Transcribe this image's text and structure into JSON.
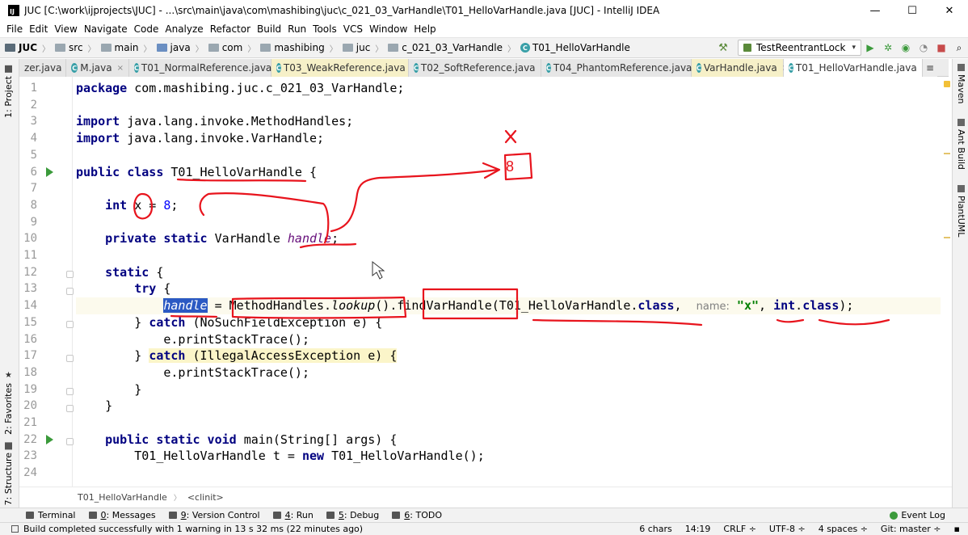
{
  "window": {
    "app_icon": "IJ",
    "title": "JUC [C:\\work\\ijprojects\\JUC] - ...\\src\\main\\java\\com\\mashibing\\juc\\c_021_03_VarHandle\\T01_HelloVarHandle.java [JUC] - IntelliJ IDEA",
    "minimize": "—",
    "maximize": "☐",
    "close": "✕"
  },
  "menu": [
    "File",
    "Edit",
    "View",
    "Navigate",
    "Code",
    "Analyze",
    "Refactor",
    "Build",
    "Run",
    "Tools",
    "VCS",
    "Window",
    "Help"
  ],
  "navbar": {
    "crumbs": [
      "JUC",
      "src",
      "main",
      "java",
      "com",
      "mashibing",
      "juc",
      "c_021_03_VarHandle",
      "T01_HelloVarHandle"
    ],
    "run_config": "TestReentrantLock",
    "hammer_icon": "hammer-icon",
    "run_icon": "run-icon",
    "debug_icon": "debug-icon"
  },
  "tabs": [
    {
      "label": "zer.java",
      "icon": "",
      "style": "plain"
    },
    {
      "label": "M.java",
      "icon": "C",
      "style": "plain"
    },
    {
      "label": "T01_NormalReference.java",
      "icon": "C",
      "style": "plain"
    },
    {
      "label": "T03_WeakReference.java",
      "icon": "C",
      "style": "yellow"
    },
    {
      "label": "T02_SoftReference.java",
      "icon": "C",
      "style": "plain"
    },
    {
      "label": "T04_PhantomReference.java",
      "icon": "C",
      "style": "plain"
    },
    {
      "label": "VarHandle.java",
      "icon": "C",
      "style": "yellow"
    },
    {
      "label": "T01_HelloVarHandle.java",
      "icon": "C",
      "style": "active"
    }
  ],
  "tab_overflow": "≡",
  "tab_close": "×",
  "left_tools": {
    "project": "1: Project",
    "favorites": "2: Favorites",
    "structure": "7: Structure"
  },
  "right_tools": {
    "maven": "Maven",
    "ant": "Ant Build",
    "plantuml": "PlantUML"
  },
  "code": {
    "line_numbers": [
      "1",
      "2",
      "3",
      "4",
      "5",
      "6",
      "7",
      "8",
      "9",
      "10",
      "11",
      "12",
      "13",
      "14",
      "15",
      "16",
      "17",
      "18",
      "19",
      "20",
      "21",
      "22",
      "23",
      "24"
    ],
    "l1": {
      "kw": "package",
      "rest": " com.mashibing.juc.c_021_03_VarHandle;"
    },
    "l3": {
      "kw": "import",
      "rest": " java.lang.invoke.MethodHandles;"
    },
    "l4": {
      "kw": "import",
      "rest": " java.lang.invoke.VarHandle;"
    },
    "l6": {
      "kw": "public class",
      "rest": " T01_HelloVarHandle {"
    },
    "l8": {
      "indent": "    ",
      "kw": "int",
      "mid": " x = ",
      "num": "8",
      "end": ";"
    },
    "l10": {
      "indent": "    ",
      "kw": "private static",
      "mid": " VarHandle ",
      "fld": "handle",
      "end": ";"
    },
    "l12": {
      "indent": "    ",
      "kw": "static",
      "rest": " {"
    },
    "l13": {
      "indent": "        ",
      "kw": "try",
      "rest": " {"
    },
    "l14": {
      "indent": "            ",
      "sel": "handle",
      "a": " = MethodHandles.",
      "b": "lookup",
      "c": "().findVarHandle(T01_HelloVarHandle.",
      "kw1": "class",
      "d": ",  ",
      "hint": "name:",
      "e": " ",
      "str": "\"x\"",
      "f": ", ",
      "kw2": "int",
      "g": ".",
      "kw3": "class",
      "h": ");"
    },
    "l15": {
      "indent": "        ",
      "pre": "} ",
      "kw": "catch",
      "rest": " (NoSuchFieldException e) {"
    },
    "l16": {
      "indent": "            ",
      "rest": "e.printStackTrace();"
    },
    "l17": {
      "indent": "        ",
      "pre": "} ",
      "kw": "catch",
      "rest": " (IllegalAccessException e) {"
    },
    "l18": {
      "indent": "            ",
      "rest": "e.printStackTrace();"
    },
    "l19": {
      "indent": "        ",
      "rest": "}"
    },
    "l20": {
      "indent": "    ",
      "rest": "}"
    },
    "l22": {
      "indent": "    ",
      "kw": "public static void",
      "rest": " main(String[] args) {"
    },
    "l23": {
      "indent": "        ",
      "a": "T01_HelloVarHandle t = ",
      "kw": "new",
      "b": " T01_HelloVarHandle();"
    }
  },
  "annotations": {
    "mark_x": "x",
    "box_value": "8"
  },
  "breadcrumb": [
    "T01_HelloVarHandle",
    "<clinit>"
  ],
  "tool_windows": {
    "terminal": "Terminal",
    "messages_num": "0",
    "messages": ": Messages",
    "vcs_num": "9",
    "vcs": ": Version Control",
    "run_num": "4",
    "run": ": Run",
    "debug_num": "5",
    "debug": ": Debug",
    "todo_num": "6",
    "todo": ": TODO",
    "event_log": "Event Log"
  },
  "status": {
    "message": "Build completed successfully with 1 warning in 13 s 32 ms (22 minutes ago)",
    "chars": "6 chars",
    "position": "14:19",
    "line_sep": "CRLF ÷",
    "encoding": "UTF-8 ÷",
    "indent": "4 spaces ÷",
    "git": "Git: master ÷"
  },
  "colors": {
    "accent_green": "#3b9a3b",
    "selection": "#2b59c3",
    "annotation_red": "#e8141d"
  }
}
